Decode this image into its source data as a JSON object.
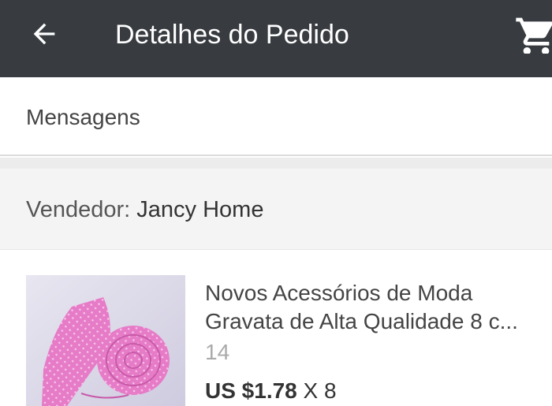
{
  "header": {
    "title": "Detalhes do Pedido",
    "back_icon": "arrow-left-icon",
    "cart_icon": "shopping-cart-icon",
    "background": "#383c41"
  },
  "messages": {
    "label": "Mensagens"
  },
  "seller": {
    "prefix": "Vendedor:",
    "name": "Jancy Home"
  },
  "product": {
    "name": "Novos Acessórios de Moda Gravata de Alta Qualidade 8 c...",
    "sub_value": "14",
    "price": "US $1.78",
    "quantity": "X 8",
    "image": "pink-necktie-image"
  }
}
